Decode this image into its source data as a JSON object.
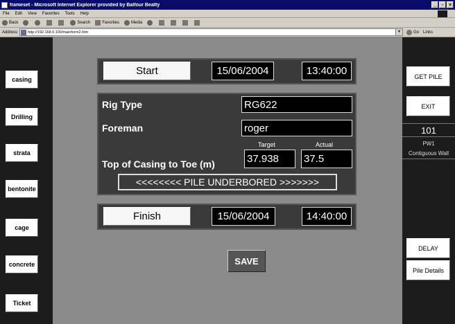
{
  "window": {
    "title": "frameset - Microsoft Internet Explorer provided by Balfour Beatty",
    "buttons": [
      "_",
      "▫",
      "×"
    ]
  },
  "menu": [
    "File",
    "Edit",
    "View",
    "Favorites",
    "Tools",
    "Help"
  ],
  "toolbar": {
    "back": "Back",
    "search": "Search",
    "favorites": "Favorites",
    "media": "Media"
  },
  "address": {
    "label": "Address",
    "url": "http://192.168.0.100/mainform2.htm",
    "go": "Go",
    "links": "Links"
  },
  "left_nav": [
    "casing",
    "Drilling",
    "strata",
    "bentonite",
    "cage",
    "concrete",
    "Ticket"
  ],
  "right_nav": {
    "get_pile": "GET PILE",
    "exit": "EXIT",
    "pile_number": "101",
    "pile_ref": "PW1",
    "wall_type": "Contiguous Wall",
    "delay": "DELAY",
    "pile_details": "Pile Details"
  },
  "start": {
    "label": "Start",
    "date": "15/06/2004",
    "time": "13:40:00"
  },
  "form": {
    "rig_type_label": "Rig Type",
    "rig_type": "RG622",
    "foreman_label": "Foreman",
    "foreman": "roger",
    "casing_label": "Top of Casing to Toe (m)",
    "target_label": "Target",
    "actual_label": "Actual",
    "target": "37.938",
    "actual": "37.5",
    "status": "<<<<<<<< PILE UNDERBORED >>>>>>>"
  },
  "finish": {
    "label": "Finish",
    "date": "15/06/2004",
    "time": "14:40:00"
  },
  "save_label": "SAVE"
}
